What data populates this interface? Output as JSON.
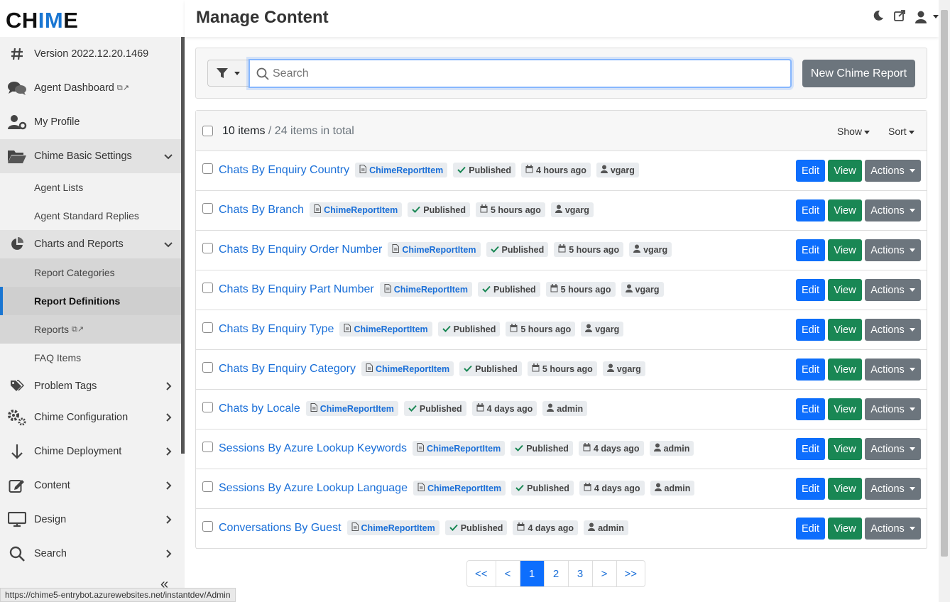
{
  "app": {
    "logo_prefix": "CH",
    "logo_accent": "IM",
    "logo_suffix": "E",
    "accent_color": "#1a76d2"
  },
  "header": {
    "title": "Manage Content"
  },
  "sidebar": {
    "items": [
      {
        "label": "Version 2022.12.20.1469",
        "icon": "hash-icon"
      },
      {
        "label": "Agent Dashboard",
        "icon": "chat-bubbles-icon",
        "external": "⧉↗"
      },
      {
        "label": "My Profile",
        "icon": "user-cog-icon"
      },
      {
        "label": "Chime Basic Settings",
        "icon": "folder-open-icon"
      },
      {
        "label": "Agent Lists"
      },
      {
        "label": "Agent Standard Replies"
      },
      {
        "label": "Charts and Reports",
        "icon": "pie-chart-icon"
      },
      {
        "label": "Report Categories"
      },
      {
        "label": "Report Definitions"
      },
      {
        "label": "Reports",
        "external": "⧉↗"
      },
      {
        "label": "FAQ Items"
      },
      {
        "label": "Problem Tags",
        "icon": "tags-icon"
      },
      {
        "label": "Chime Configuration",
        "icon": "gears-icon"
      },
      {
        "label": "Chime Deployment",
        "icon": "arrow-down-icon"
      },
      {
        "label": "Content",
        "icon": "edit-icon"
      },
      {
        "label": "Design",
        "icon": "monitor-icon"
      },
      {
        "label": "Search",
        "icon": "search-icon"
      }
    ],
    "collapse": "«"
  },
  "status_url": "https://chime5-entrybot.azurewebsites.net/instantdev/Admin",
  "search": {
    "placeholder": "Search",
    "new_button": "New Chime Report"
  },
  "list": {
    "count": "10 items",
    "total": " / 24 items in total",
    "show": "Show",
    "sort": "Sort",
    "rows": [
      {
        "title": "Chats By Enquiry Country",
        "type": "ChimeReportItem",
        "status": "Published",
        "time": "4 hours ago",
        "user": "vgarg"
      },
      {
        "title": "Chats By Branch",
        "type": "ChimeReportItem",
        "status": "Published",
        "time": "5 hours ago",
        "user": "vgarg"
      },
      {
        "title": "Chats By Enquiry Order Number",
        "type": "ChimeReportItem",
        "status": "Published",
        "time": "5 hours ago",
        "user": "vgarg"
      },
      {
        "title": "Chats By Enquiry Part Number",
        "type": "ChimeReportItem",
        "status": "Published",
        "time": "5 hours ago",
        "user": "vgarg"
      },
      {
        "title": "Chats By Enquiry Type",
        "type": "ChimeReportItem",
        "status": "Published",
        "time": "5 hours ago",
        "user": "vgarg"
      },
      {
        "title": "Chats By Enquiry Category",
        "type": "ChimeReportItem",
        "status": "Published",
        "time": "5 hours ago",
        "user": "vgarg"
      },
      {
        "title": "Chats by Locale",
        "type": "ChimeReportItem",
        "status": "Published",
        "time": "4 days ago",
        "user": "admin"
      },
      {
        "title": "Sessions By Azure Lookup Keywords",
        "type": "ChimeReportItem",
        "status": "Published",
        "time": "4 days ago",
        "user": "admin"
      },
      {
        "title": "Sessions By Azure Lookup Language",
        "type": "ChimeReportItem",
        "status": "Published",
        "time": "4 days ago",
        "user": "admin"
      },
      {
        "title": "Conversations By Guest",
        "type": "ChimeReportItem",
        "status": "Published",
        "time": "4 days ago",
        "user": "admin"
      }
    ],
    "buttons": {
      "edit": "Edit",
      "view": "View",
      "actions": "Actions"
    }
  },
  "pager": {
    "first": "<<",
    "prev": "<",
    "pages": [
      "1",
      "2",
      "3"
    ],
    "current": "1",
    "next": ">",
    "last": ">>"
  }
}
